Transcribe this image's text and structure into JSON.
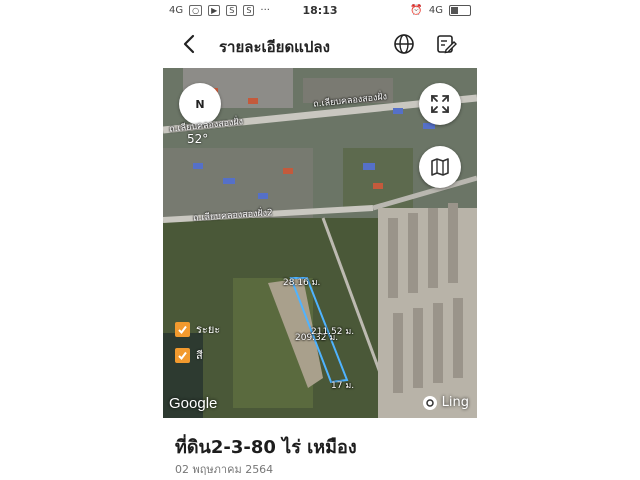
{
  "status_bar": {
    "network_left": "4G",
    "time": "18:13",
    "network_right": "4G",
    "app_icons": [
      "chat-icon",
      "youtube-icon",
      "s-icon",
      "s-icon",
      "more-dots"
    ]
  },
  "app_bar": {
    "title": "รายละเอียดแปลง",
    "icons": [
      "back-arrow-icon",
      "globe-icon",
      "edit-icon"
    ]
  },
  "map": {
    "compass_label": "N",
    "heading": "52°",
    "road_labels": [
      "ถ.เลียบคลองสองฝั่ง",
      "ถ.เลียบคลองสองฝั่ง",
      "ถ.เลียบคลองสองฝั่ง2"
    ],
    "dimensions": [
      "28.16 ม.",
      "209.32 ม.",
      "211.52 ม.",
      "17 ม."
    ],
    "layers": [
      {
        "label": "ระยะ",
        "checked": true
      },
      {
        "label": "สี",
        "checked": true
      }
    ],
    "attribution": "Google",
    "brand": "Ling",
    "colors": {
      "checkbox": "#f29a2e",
      "plot_outline": "#4fb3ff"
    }
  },
  "plot": {
    "title": "ที่ดิน2-3-80 ไร่ เหมือง",
    "date": "02 พฤษภาคม 2564"
  }
}
